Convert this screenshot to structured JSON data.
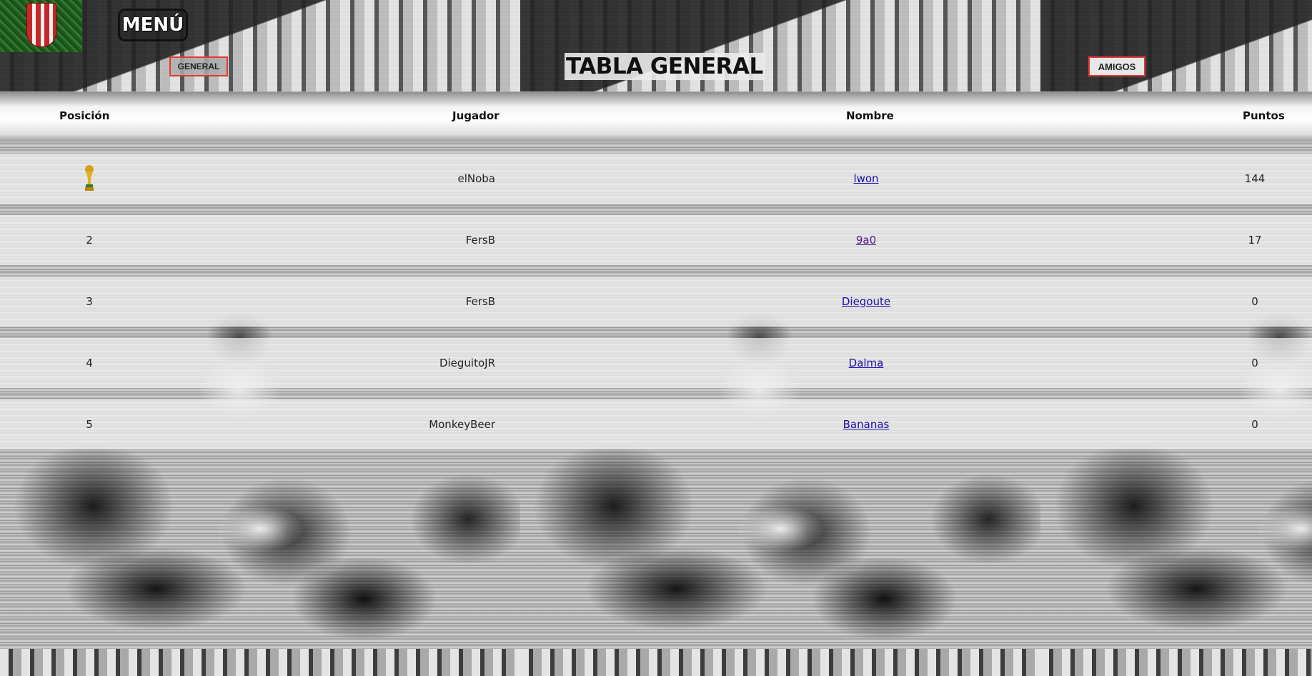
{
  "header": {
    "menu_label": "MENÚ",
    "tab_general": "GENERAL",
    "tab_amigos": "AMIGOS",
    "title": "TABLA GENERAL"
  },
  "table": {
    "columns": [
      "Posición",
      "Jugador",
      "Nombre",
      "Puntos"
    ],
    "rows": [
      {
        "position": "",
        "position_icon": "trophy-icon",
        "player": "elNoba",
        "name": "lwon",
        "points": "144"
      },
      {
        "position": "2",
        "player": "FersB",
        "name": "9a0",
        "points": "17"
      },
      {
        "position": "3",
        "player": "FersB",
        "name": "Diegoute",
        "points": "0"
      },
      {
        "position": "4",
        "player": "DieguitoJR",
        "name": "Dalma",
        "points": "0"
      },
      {
        "position": "5",
        "player": "MonkeyBeer",
        "name": "Bananas",
        "points": "0"
      }
    ]
  },
  "colors": {
    "tab_border": "#e53935",
    "link": "#1a0dab",
    "link_visited": "#551a8b",
    "logo_green": "#2f7a2f",
    "logo_red": "#c62828"
  }
}
